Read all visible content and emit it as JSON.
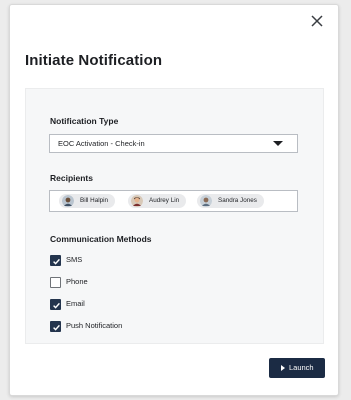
{
  "dialog": {
    "title": "Initiate Notification",
    "close_icon": "close-icon"
  },
  "notification_type": {
    "label": "Notification Type",
    "selected": "EOC Activation - Check-in",
    "caret_icon": "caret-down-icon"
  },
  "recipients": {
    "label": "Recipients",
    "items": [
      {
        "name": "Bill Halpin",
        "avatar_icon": "avatar-icon"
      },
      {
        "name": "Audrey Lin",
        "avatar_icon": "avatar-icon"
      },
      {
        "name": "Sandra Jones",
        "avatar_icon": "avatar-icon"
      }
    ]
  },
  "methods": {
    "label": "Communication Methods",
    "items": [
      {
        "label": "SMS",
        "checked": true
      },
      {
        "label": "Phone",
        "checked": false
      },
      {
        "label": "Email",
        "checked": true
      },
      {
        "label": "Push Notification",
        "checked": true
      }
    ]
  },
  "footer": {
    "launch_label": "Launch",
    "launch_icon": "play-icon"
  },
  "colors": {
    "primary": "#1b2b44",
    "checkbox_on": "#23344d",
    "panel_bg": "#f6f7f8"
  }
}
